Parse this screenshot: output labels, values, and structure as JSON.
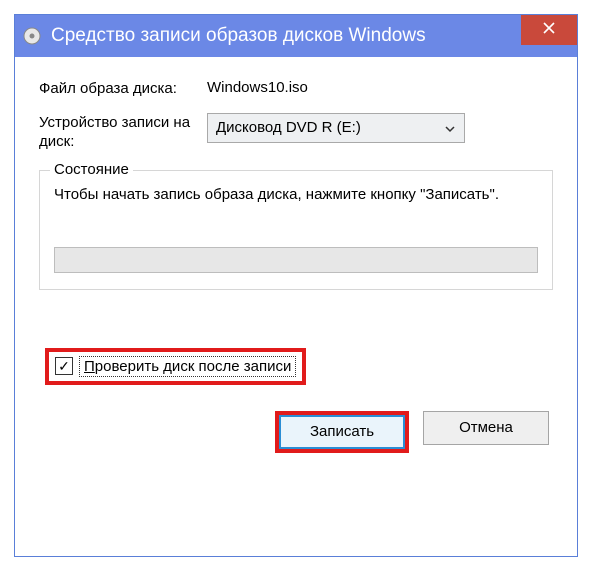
{
  "window": {
    "title": "Средство записи образов дисков Windows"
  },
  "form": {
    "image_file_label": "Файл образа диска:",
    "image_file_value": "Windows10.iso",
    "burner_label": "Устройство записи на диск:",
    "burner_value": "Дисковод DVD R (E:)"
  },
  "status": {
    "legend": "Состояние",
    "text": "Чтобы начать запись образа диска, нажмите кнопку \"Записать\"."
  },
  "verify": {
    "label": "Проверить диск после записи",
    "checked": true
  },
  "buttons": {
    "burn": "Записать",
    "cancel": "Отмена"
  }
}
